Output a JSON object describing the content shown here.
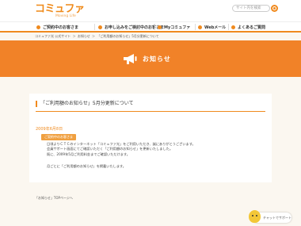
{
  "brand": {
    "logo_text": "コミュファ",
    "tagline": "Moving Life",
    "accent_color": "#f08a1e"
  },
  "header": {
    "search_placeholder": "サイト内を検索"
  },
  "nav": {
    "items": [
      {
        "label": "ご契約中のお客さま"
      },
      {
        "label": "お申し込みをご検討中のお客さま"
      },
      {
        "label": "Myコミュファ"
      },
      {
        "label": "Webメール"
      },
      {
        "label": "よくあるご質問"
      }
    ]
  },
  "breadcrumb": [
    "コミュファ光 公式サイト",
    "＞",
    "お知らせ",
    "＞",
    "「ご利用額のお知らせ」5月分更新について"
  ],
  "hero": {
    "title": "お知らせ"
  },
  "article": {
    "title": "「ご利用額のお知らせ」5月分更新について",
    "date": "2009年6月8日",
    "badge": "ご契約中のお客さま",
    "paragraph_lines": [
      "日頃よりＣＴＣのインターネット「コミュファ光」をご利用いただき、誠にありがとうございます。",
      "会員サポート画面にてご確認いただく「ご利用額のお知らせ」を更新いたしました。",
      "既に、2009年5月ご利用料金までご確認いただけます。"
    ],
    "paragraph2": "月ごとに「ご利用額のお知らせ」を掲載いたします。"
  },
  "footer": {
    "top_link": "「お知らせ」TOPページへ"
  },
  "chat": {
    "label": "チャットでサポート"
  }
}
